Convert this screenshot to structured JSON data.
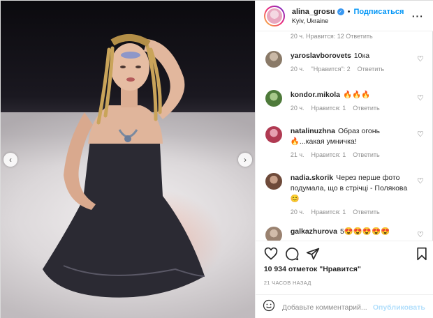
{
  "header": {
    "username": "alina_grosu",
    "follow_label": "Подписаться",
    "separator": "•",
    "location": "Kyiv, Ukraine",
    "more_label": "···"
  },
  "photo": {
    "prev_arrow": "‹",
    "next_arrow": "›"
  },
  "partial_comment_meta": "20 ч.   Нравится: 12   Ответить",
  "comments": [
    {
      "username": "yaroslavborovets",
      "text": "10ка",
      "time": "20 ч.",
      "likes": "\"Нравится\": 2",
      "reply": "Ответить",
      "avatar_color": "#8a7a68"
    },
    {
      "username": "kondor.mikola",
      "text": "🔥🔥🔥",
      "time": "20 ч.",
      "likes": "Нравится: 1",
      "reply": "Ответить",
      "avatar_color": "#4e7a3a"
    },
    {
      "username": "natalinuzhna",
      "text": "Образ огонь 🔥...какая умничка!",
      "time": "21 ч.",
      "likes": "Нравится: 1",
      "reply": "Ответить",
      "avatar_color": "#b03a52"
    },
    {
      "username": "nadia.skorik",
      "text": "Через перше фото подумала, що в стрічці - Полякова😊",
      "time": "20 ч.",
      "likes": "Нравится: 1",
      "reply": "Ответить",
      "avatar_color": "#6e4a3a"
    },
    {
      "username": "galkazhurova",
      "text": "5😍😍😍😍😍",
      "avatar_color": "#9a8270"
    }
  ],
  "actions": {
    "likes_text": "10 934 отметок \"Нравится\"",
    "time_text": "21 ЧАСОВ НАЗАД"
  },
  "add_comment": {
    "placeholder": "Добавьте комментарий...",
    "publish_label": "Опубликовать"
  },
  "colors": {
    "accent": "#0095f6",
    "verified": "#3897f0",
    "muted": "#8e8e8e",
    "publish_disabled": "#b2dffc"
  }
}
